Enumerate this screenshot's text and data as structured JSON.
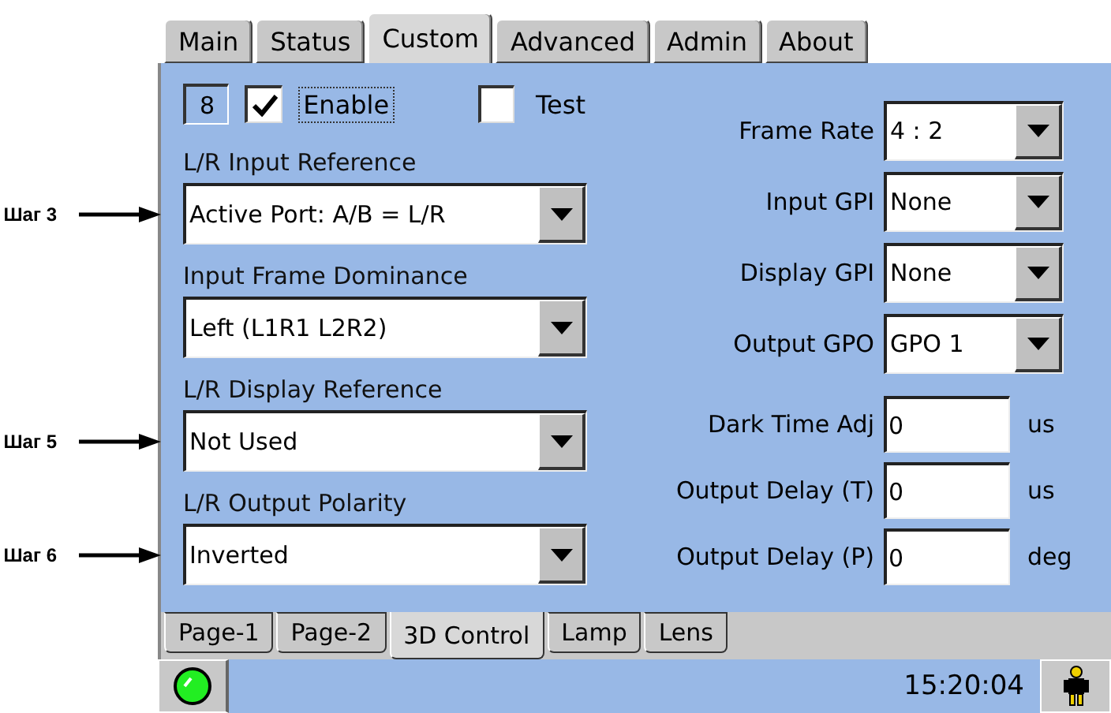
{
  "top_tabs": [
    {
      "label": "Main",
      "selected": false
    },
    {
      "label": "Status",
      "selected": false
    },
    {
      "label": "Custom",
      "selected": true
    },
    {
      "label": "Advanced",
      "selected": false
    },
    {
      "label": "Admin",
      "selected": false
    },
    {
      "label": "About",
      "selected": false
    }
  ],
  "channel": "8",
  "enable": {
    "label": "Enable",
    "checked": true,
    "focused": true
  },
  "test": {
    "label": "Test",
    "checked": false,
    "focused": false
  },
  "left_fields": [
    {
      "label": "L/R Input Reference",
      "value": "Active Port: A/B = L/R",
      "callout": "Шаг 3"
    },
    {
      "label": "Input Frame Dominance",
      "value": "Left (L1R1 L2R2)"
    },
    {
      "label": "L/R Display Reference",
      "value": "Not Used",
      "callout": "Шаг 5"
    },
    {
      "label": "L/R Output Polarity",
      "value": "Inverted",
      "callout": "Шаг 6"
    }
  ],
  "right_selects": [
    {
      "label": "Frame Rate",
      "value": "4 : 2"
    },
    {
      "label": "Input GPI",
      "value": "None"
    },
    {
      "label": "Display GPI",
      "value": "None"
    },
    {
      "label": "Output GPO",
      "value": "GPO 1"
    }
  ],
  "right_inputs": [
    {
      "label": "Dark Time Adj",
      "value": "0",
      "unit": "us"
    },
    {
      "label": "Output Delay (T)",
      "value": "0",
      "unit": "us"
    },
    {
      "label": "Output Delay (P)",
      "value": "0",
      "unit": "deg"
    }
  ],
  "bottom_tabs": [
    {
      "label": "Page-1",
      "selected": false
    },
    {
      "label": "Page-2",
      "selected": false
    },
    {
      "label": "3D Control",
      "selected": true
    },
    {
      "label": "Lamp",
      "selected": false
    },
    {
      "label": "Lens",
      "selected": false
    }
  ],
  "status_bar": {
    "led_on": true,
    "time": "15:20:04"
  }
}
